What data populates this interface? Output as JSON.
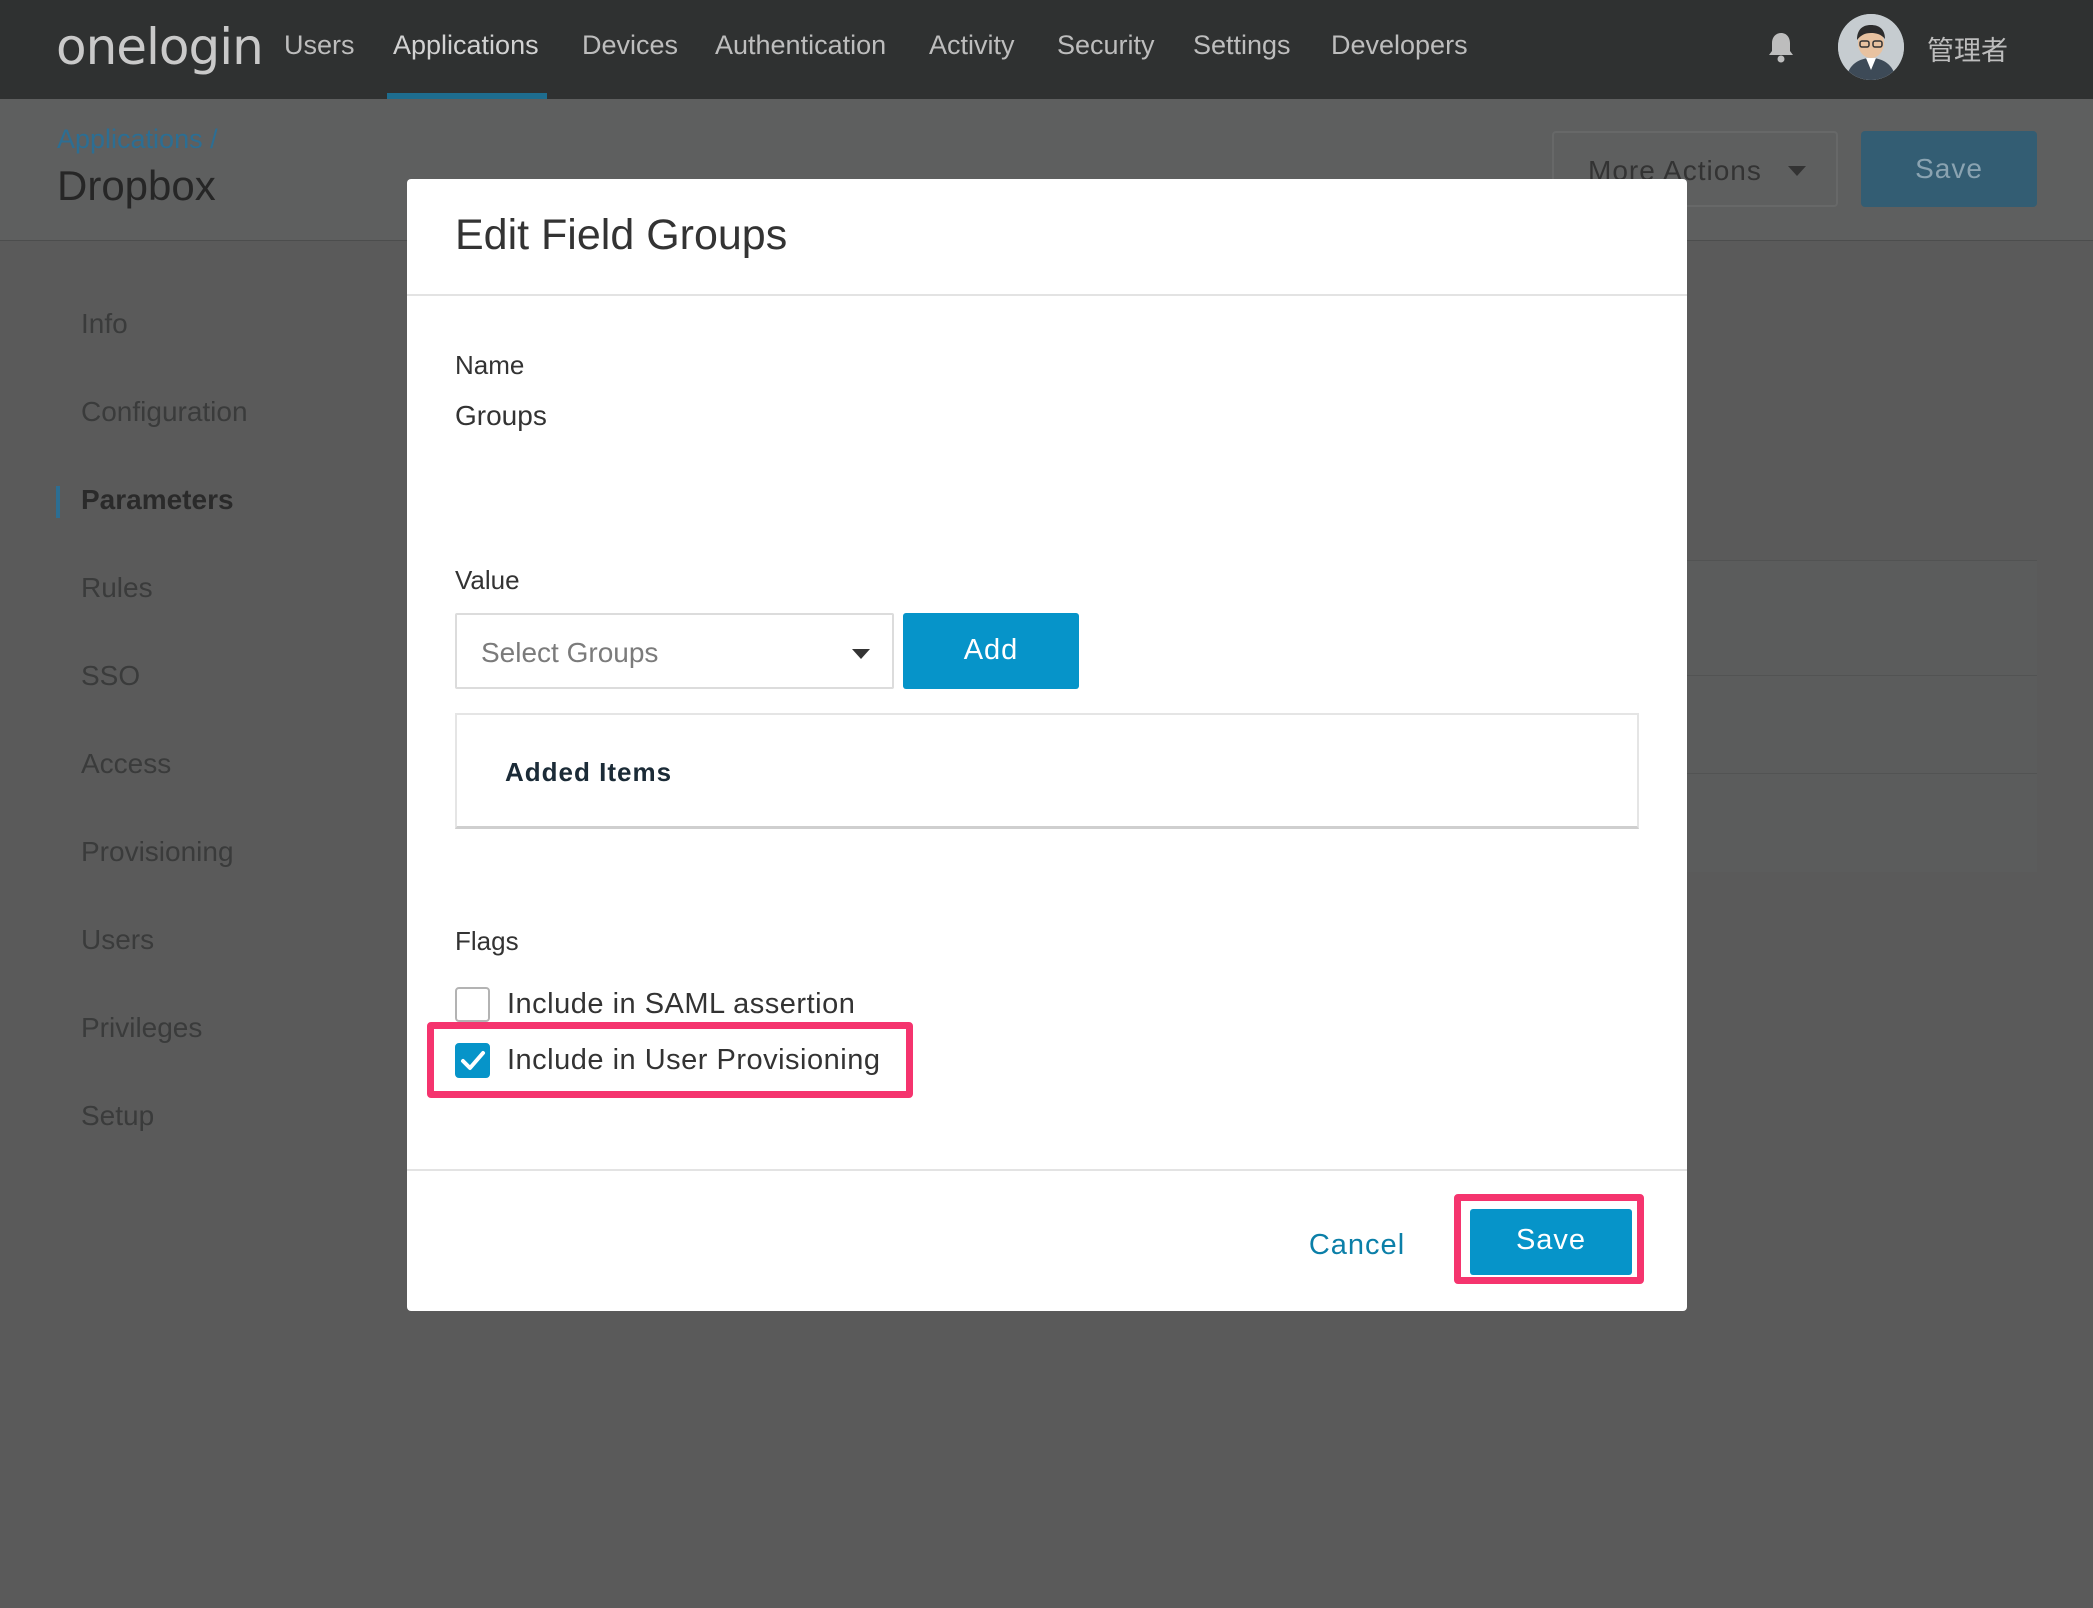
{
  "topnav": {
    "logo": "onelogin",
    "items": [
      "Users",
      "Applications",
      "Devices",
      "Authentication",
      "Activity",
      "Security",
      "Settings",
      "Developers"
    ],
    "active_item": "Applications",
    "bell_icon": "bell-icon",
    "user_name": "管理者"
  },
  "header": {
    "breadcrumb": "Applications /",
    "title": "Dropbox",
    "more_actions_label": "More Actions",
    "save_label": "Save"
  },
  "sidebar": {
    "items": [
      {
        "label": "Info"
      },
      {
        "label": "Configuration"
      },
      {
        "label": "Parameters"
      },
      {
        "label": "Rules"
      },
      {
        "label": "SSO"
      },
      {
        "label": "Access"
      },
      {
        "label": "Provisioning"
      },
      {
        "label": "Users"
      },
      {
        "label": "Privileges"
      },
      {
        "label": "Setup"
      }
    ],
    "active_item": "Parameters"
  },
  "modal": {
    "title": "Edit Field Groups",
    "name_label": "Name",
    "name_value": "Groups",
    "value_label": "Value",
    "select_placeholder": "Select Groups",
    "add_label": "Add",
    "added_items_title": "Added Items",
    "flags_label": "Flags",
    "flags": [
      {
        "label": "Include in SAML assertion",
        "checked": false
      },
      {
        "label": "Include in User Provisioning",
        "checked": true
      }
    ],
    "cancel_label": "Cancel",
    "save_label": "Save"
  },
  "colors": {
    "accent": "#0694c9",
    "highlight": "#f5346e",
    "nav_bg": "#2f3131",
    "overlay": "#5a5a5a"
  }
}
